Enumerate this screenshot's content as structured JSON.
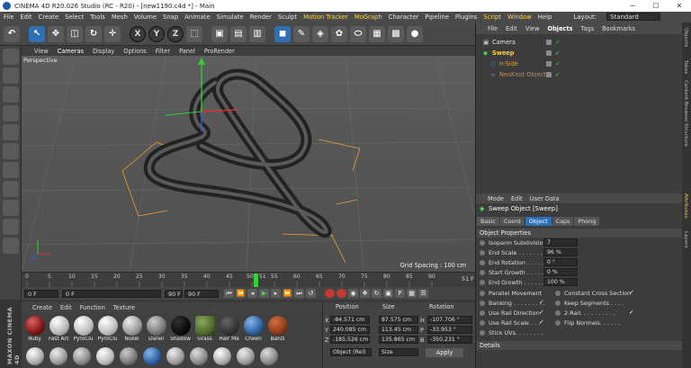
{
  "window": {
    "title": "CINEMA 4D R20.026 Studio (RC - R20) - [new1190.c4d *] - Main",
    "minimize": "─",
    "maximize": "☐",
    "close": "✕"
  },
  "menu": [
    "File",
    "Edit",
    "Create",
    "Select",
    "Tools",
    "Mesh",
    "Volume",
    "Snap",
    "Animate",
    "Simulate",
    "Render",
    "Sculpt",
    "Motion Tracker",
    "MoGraph",
    "Character",
    "Pipeline",
    "Plugins",
    "Script",
    "Window",
    "Help"
  ],
  "layout": {
    "label": "Layout:",
    "value": "Standard"
  },
  "toolbar": {
    "x": "X",
    "y": "Y",
    "z": "Z"
  },
  "viewport": {
    "menu": [
      "View",
      "Cameras",
      "Display",
      "Options",
      "Filter",
      "Panel",
      "ProRender"
    ],
    "label": "Perspective",
    "grid_spacing": "Grid Spacing : 100 cm"
  },
  "timeline": {
    "ticks": [
      "0",
      "5",
      "10",
      "15",
      "20",
      "25",
      "30",
      "35",
      "40",
      "45",
      "50",
      "51",
      "55",
      "60",
      "65",
      "70",
      "75",
      "80",
      "85",
      "90"
    ],
    "current_frame": "51",
    "frame_indicator": "51 F"
  },
  "playback": {
    "start": "0 F",
    "current": "0 F",
    "end_a": "90 F",
    "end_b": "90 F"
  },
  "materials": {
    "menu": [
      "Create",
      "Edit",
      "Function",
      "Texture"
    ],
    "items": [
      {
        "label": "Ruby",
        "color": "#7a1515"
      },
      {
        "label": "Fast Arc",
        "color": "#d8d8d8"
      },
      {
        "label": "PyroClu",
        "color": "#cfcfcf"
      },
      {
        "label": "PyroClu",
        "color": "#cfcfcf"
      },
      {
        "label": "Nukei",
        "color": "#b8b8b8"
      },
      {
        "label": "Danel",
        "color": "#8a8a8a"
      },
      {
        "label": "Shadow",
        "color": "#111111"
      },
      {
        "label": "Grass",
        "color": "#4f6a2a"
      },
      {
        "label": "Hair Ma",
        "color": "#3a3a3a"
      },
      {
        "label": "Cheen",
        "color": "#2b5fa0"
      },
      {
        "label": "Banzi",
        "color": "#8b3a1c"
      }
    ]
  },
  "brand": "MAXON CINEMA 4D",
  "coords": {
    "headers": [
      "Position",
      "Size",
      "Rotation"
    ],
    "rows": [
      {
        "axis": "X",
        "pos": "-84.571 cm",
        "size": "87.575 cm",
        "rot_label": "H",
        "rot": "-107.706 °"
      },
      {
        "axis": "Y",
        "pos": "240.085 cm",
        "size": "113.45 cm",
        "rot_label": "P",
        "rot": "-33.953 °"
      },
      {
        "axis": "Z",
        "pos": "-185.526 cm",
        "size": "135.865 cm",
        "rot_label": "B",
        "rot": "-350.231 °"
      }
    ],
    "mode": "Object (Rel)",
    "size_mode": "Size",
    "apply": "Apply"
  },
  "objects": {
    "menu": [
      "File",
      "Edit",
      "View",
      "Objects",
      "Tags",
      "Bookmarks"
    ],
    "items": [
      {
        "name": "Camera",
        "color": "#e6e6e6",
        "indent": 0
      },
      {
        "name": "Sweep",
        "color": "#ffcf3a",
        "indent": 0
      },
      {
        "name": "n-Side",
        "color": "#e0a04a",
        "indent": 1
      },
      {
        "name": "NeoKnot Object",
        "color": "#c58a5a",
        "indent": 1
      }
    ]
  },
  "side_tabs": [
    "Objects",
    "Takes",
    "Content Browser",
    "Structure",
    "Attributes",
    "Layers"
  ],
  "attributes": {
    "menu": [
      "Mode",
      "Edit",
      "User Data"
    ],
    "title": "Sweep Object [Sweep]",
    "tabs": [
      "Basic",
      "Coord",
      "Object",
      "Caps",
      "Phong"
    ],
    "section": "Object Properties",
    "fields": [
      {
        "label": "Isoparm Subdivision",
        "value": "7"
      },
      {
        "label": "End Scale . . . . . . . .",
        "value": "96 %"
      },
      {
        "label": "End Rotation . . . . . .",
        "value": "0 °"
      },
      {
        "label": "Start Growth . . . . . .",
        "value": "0 %"
      },
      {
        "label": "End Growth . . . . . .",
        "value": "100 %"
      }
    ],
    "checks_left": [
      {
        "label": "Parallel Movement",
        "checked": false
      },
      {
        "label": "Banking . . . . . . . . .",
        "checked": true
      },
      {
        "label": "Use Rail Direction",
        "checked": true
      },
      {
        "label": "Use Rail Scale . . .",
        "checked": true
      },
      {
        "label": "Stick UVs. . . . . . . .",
        "checked": false
      }
    ],
    "checks_right": [
      {
        "label": "Constant Cross Section",
        "checked": true
      },
      {
        "label": "Keep Segments . . . .",
        "checked": false
      },
      {
        "label": "2-Rail. . . . . . . . . .",
        "checked": true
      },
      {
        "label": "Flip Normals. . . . . .",
        "checked": false
      }
    ],
    "details": "Details",
    "check_glyph": "✓"
  }
}
